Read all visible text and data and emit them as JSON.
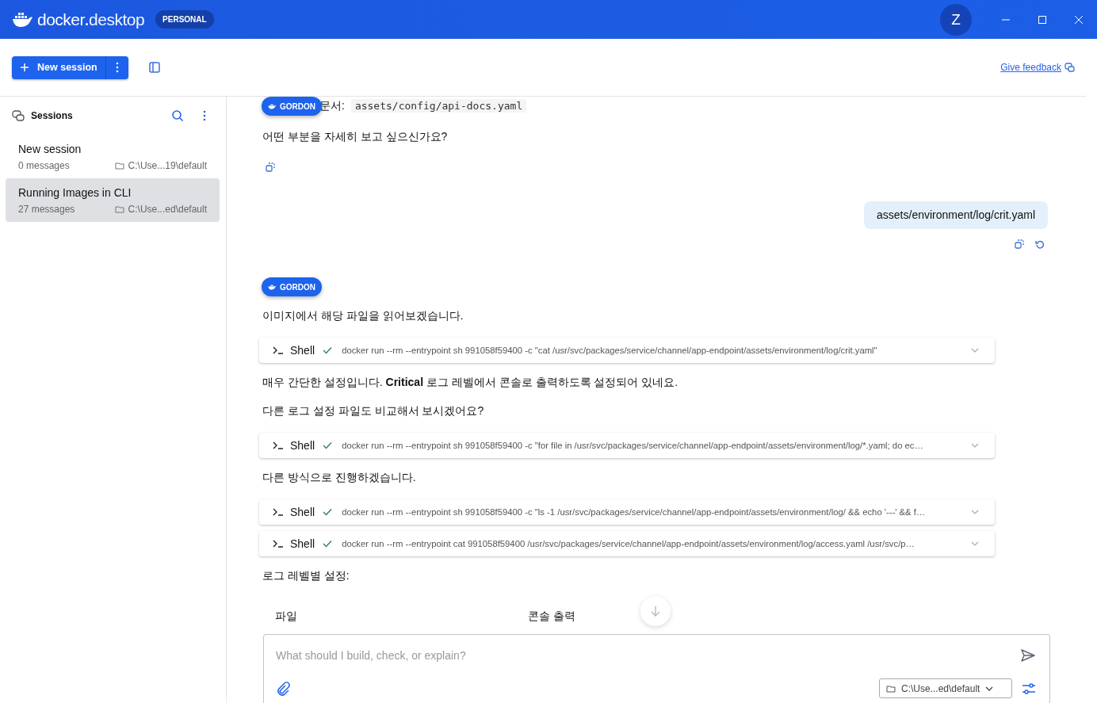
{
  "titlebar": {
    "brand": [
      "docker",
      "desktop"
    ],
    "plan": "PERSONAL",
    "avatar": "Z"
  },
  "toolbar": {
    "new_session": "New session",
    "feedback": "Give feedback"
  },
  "sidebar": {
    "title": "Sessions",
    "sessions": [
      {
        "title": "New session",
        "count": "0 messages",
        "path": "C:\\Use...19\\default",
        "selected": false
      },
      {
        "title": "Running Images in CLI",
        "count": "27 messages",
        "path": "C:\\Use...ed\\default",
        "selected": true
      }
    ]
  },
  "chat": {
    "sticky_badge": "GORDON",
    "messages": [
      {
        "kind": "file_ref",
        "label": "문서:",
        "code": "assets/config/api-docs.yaml"
      },
      {
        "kind": "text",
        "text": "어떤 부분을 자세히 보고 싶으신가요?"
      },
      {
        "kind": "bot_actions"
      },
      {
        "kind": "user",
        "text": "assets/environment/log/crit.yaml"
      },
      {
        "kind": "user_actions"
      },
      {
        "kind": "badge",
        "text": "GORDON"
      },
      {
        "kind": "text",
        "text": "이미지에서 해당 파일을 읽어보겠습니다."
      },
      {
        "kind": "tool",
        "label": "Shell",
        "done": true,
        "command": "docker run --rm --entrypoint sh 991058f59400 -c \"cat /usr/svc/packages/service/channel/app-endpoint/assets/environment/log/crit.yaml\""
      },
      {
        "kind": "text",
        "text": "매우 간단한 설정입니다. **Critical** 로그 레벨에서 콘솔로 출력하도록 설정되어 있네요."
      },
      {
        "kind": "text",
        "text": "다른 로그 설정 파일도 비교해서 보시겠어요?"
      },
      {
        "kind": "tool",
        "label": "Shell",
        "done": true,
        "command": "docker run --rm --entrypoint sh 991058f59400 -c \"for file in /usr/svc/packages/service/channel/app-endpoint/assets/environment/log/*.yaml; do ec…"
      },
      {
        "kind": "text",
        "text": "다른 방식으로 진행하겠습니다."
      },
      {
        "kind": "tool",
        "label": "Shell",
        "done": true,
        "command": "docker run --rm --entrypoint sh 991058f59400 -c \"ls -1 /usr/svc/packages/service/channel/app-endpoint/assets/environment/log/ && echo '---' && f…"
      },
      {
        "kind": "tool",
        "label": "Shell",
        "done": true,
        "command": "docker run --rm --entrypoint cat 991058f59400 /usr/svc/packages/service/channel/app-endpoint/assets/environment/log/access.yaml /usr/svc/p…"
      },
      {
        "kind": "text",
        "text": "로그 레벨별 설정:"
      },
      {
        "kind": "table_head",
        "columns": [
          "파일",
          "콘솔 출력"
        ]
      }
    ]
  },
  "composer": {
    "placeholder": "What should I build, check, or explain?",
    "path": "C:\\Use...ed\\default"
  }
}
